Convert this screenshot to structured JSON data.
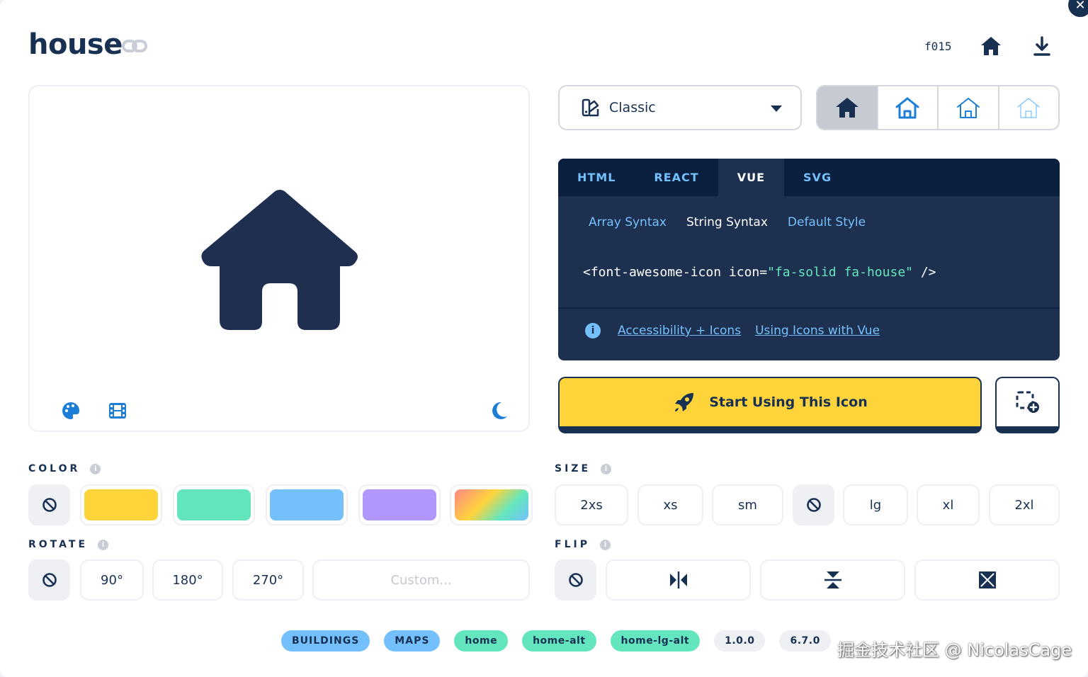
{
  "header": {
    "title": "house",
    "unicode": "f015"
  },
  "family_select": {
    "label": "Classic"
  },
  "code": {
    "tabs": [
      "HTML",
      "REACT",
      "VUE",
      "SVG"
    ],
    "subtabs": [
      "Array Syntax",
      "String Syntax",
      "Default Style"
    ],
    "code_tag_open": "<font-awesome-icon icon=",
    "code_value": "\"fa-solid fa-house\"",
    "code_tag_close": " />",
    "links": [
      "Accessibility + Icons",
      "Using Icons with Vue"
    ]
  },
  "cta": {
    "start_label": "Start Using This Icon"
  },
  "color": {
    "label": "COLOR",
    "swatches": [
      "#ffd43b",
      "#63e6be",
      "#74c0fc",
      "#b197fc"
    ]
  },
  "size": {
    "label": "SIZE",
    "options": [
      "2xs",
      "xs",
      "sm",
      "lg",
      "xl",
      "2xl"
    ]
  },
  "rotate": {
    "label": "ROTATE",
    "options": [
      "90°",
      "180°",
      "270°"
    ],
    "custom_placeholder": "Custom..."
  },
  "flip": {
    "label": "FLIP"
  },
  "tags": {
    "categories": [
      "BUILDINGS",
      "MAPS"
    ],
    "aliases": [
      "home",
      "home-alt",
      "home-lg-alt"
    ],
    "versions": [
      "1.0.0",
      "6.7.0"
    ]
  },
  "watermark": "掘金技术社区 @ NicolasCage",
  "colors": {
    "navy": "#183153",
    "yellow": "#ffd43b",
    "code_bg": "#1e3050",
    "link_blue": "#74c0fc",
    "green": "#63e6be"
  }
}
